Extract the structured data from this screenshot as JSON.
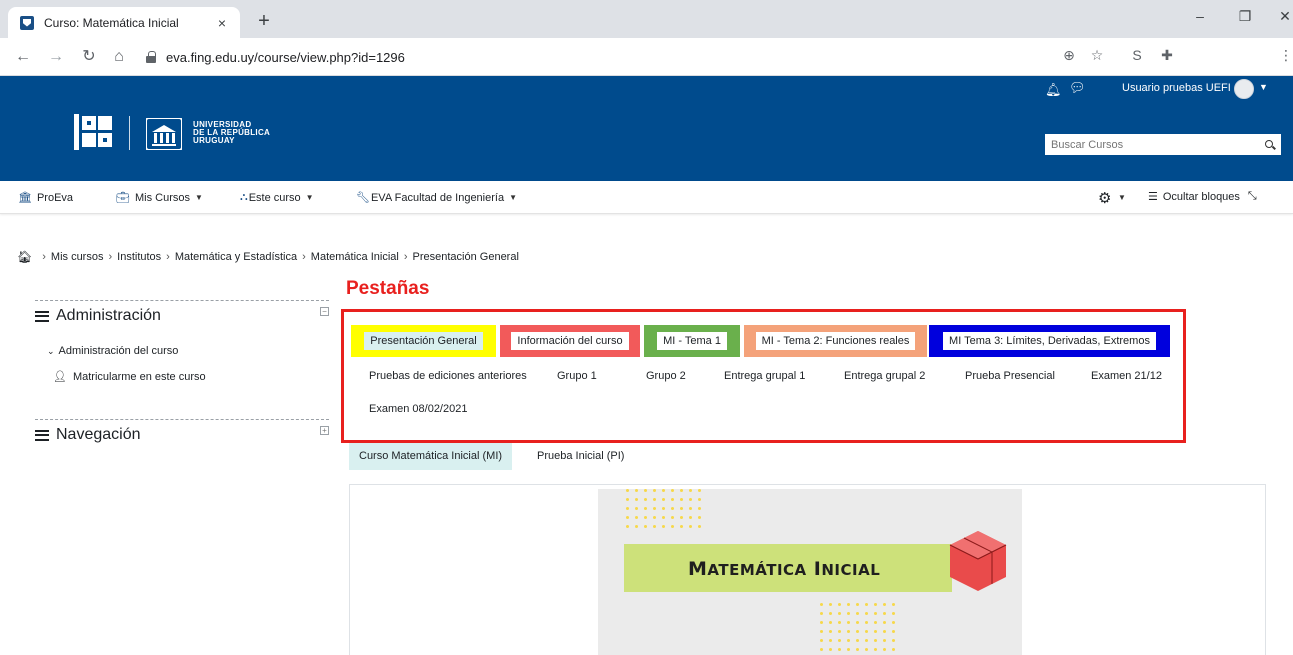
{
  "browser": {
    "tab_title": "Curso: Matemática Inicial",
    "tab_close": "×",
    "new_tab": "+",
    "url": "eva.fing.edu.uy/course/view.php?id=1296",
    "window_min": "–",
    "window_max": "❐",
    "window_close": "✕"
  },
  "header": {
    "university_line1": "UNIVERSIDAD",
    "university_line2": "DE LA REPÚBLICA",
    "university_line3": "URUGUAY",
    "user_name": "Usuario pruebas UEFI",
    "search_placeholder": "Buscar Cursos"
  },
  "navbar": {
    "items": [
      {
        "label": "ProEva",
        "icon": "institution-icon"
      },
      {
        "label": "Mis Cursos",
        "icon": "briefcase-icon"
      },
      {
        "label": "Este curso",
        "icon": "sitemap-icon"
      },
      {
        "label": "EVA Facultad de Ingeniería",
        "icon": "wrench-icon"
      }
    ],
    "hide_blocks": "Ocultar bloques"
  },
  "breadcrumb": [
    "Mis cursos",
    "Institutos",
    "Matemática y Estadística",
    "Matemática Inicial",
    "Presentación General"
  ],
  "sidebar": {
    "admin_title": "Administración",
    "admin_course": "Administración del curso",
    "enrol": "Matricularme en este curso",
    "nav_title": "Navegación"
  },
  "main": {
    "annotation_title": "Pestañas",
    "tabs_row1": [
      {
        "label": "Presentación General",
        "color": "#ffff00"
      },
      {
        "label": "Información del curso",
        "color": "#f25a5a"
      },
      {
        "label": "MI - Tema 1",
        "color": "#6ab04c"
      },
      {
        "label": "MI - Tema 2: Funciones reales",
        "color": "#f4a27a"
      },
      {
        "label": "MI Tema 3: Límites, Derivadas, Extremos",
        "color": "#0000dd"
      }
    ],
    "tabs_row2": [
      "Pruebas de ediciones anteriores",
      "Grupo 1",
      "Grupo 2",
      "Entrega grupal 1",
      "Entrega grupal 2",
      "Prueba Presencial",
      "Examen 21/12"
    ],
    "tabs_row3": [
      "Examen 08/02/2021"
    ],
    "subtabs": [
      "Curso Matemática Inicial (MI)",
      "Prueba Inicial (PI)"
    ],
    "banner_word1": "M",
    "banner_word1_rest": "ATEMÁTICA",
    "banner_word2": "I",
    "banner_word2_rest": "NICIAL"
  },
  "colors": {
    "header_blue": "#004b8d",
    "annotation_red": "#e8201e",
    "active_tab_bg": "#d9f0f0"
  }
}
